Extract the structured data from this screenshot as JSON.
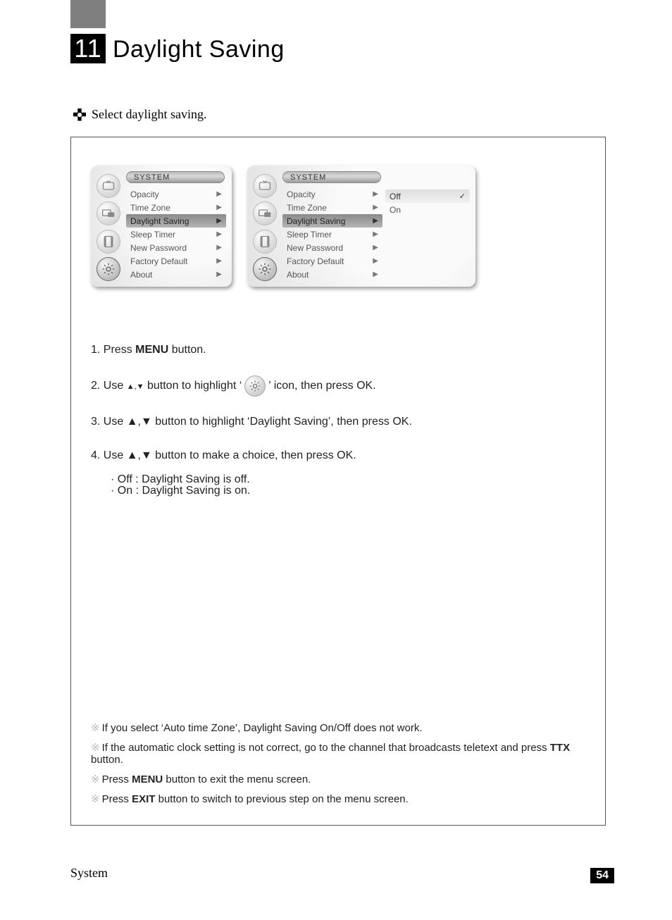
{
  "chapter": {
    "number": "11",
    "title": "Daylight Saving"
  },
  "intro": "Select daylight saving.",
  "osd": {
    "header": "SYSTEM",
    "items": [
      {
        "label": "Opacity",
        "selected": false
      },
      {
        "label": "Time Zone",
        "selected": false
      },
      {
        "label": "Daylight Saving",
        "selected": true
      },
      {
        "label": "Sleep Timer",
        "selected": false
      },
      {
        "label": "New Password",
        "selected": false
      },
      {
        "label": "Factory Default",
        "selected": false
      },
      {
        "label": "About",
        "selected": false
      }
    ],
    "options": [
      {
        "label": "Off",
        "selected": true
      },
      {
        "label": "On",
        "selected": false
      }
    ]
  },
  "steps": {
    "s1_pre": "1. Press ",
    "s1_b": "MENU",
    "s1_post": " button.",
    "s2_pre": "2. Use ",
    "s2_mid": " button to highlight ‘",
    "s2_post": "’ icon, then press OK.",
    "s3": "3. Use ▲,▼ button to highlight ‘Daylight Saving’, then press OK.",
    "s4": "4. Use ▲,▼ button to make a choice, then press OK.",
    "s4a": "· Off : Daylight Saving is off.",
    "s4b": "· On : Daylight Saving is on.",
    "arrows": "▲,▼"
  },
  "notes": {
    "n1": "If you select ‘Auto time Zone’, Daylight Saving On/Off does not work.",
    "n2_pre": "If the automatic clock setting is not correct, go to the channel that broadcasts teletext and press ",
    "n2_b": "TTX",
    "n2_post": " button.",
    "n3_pre": "Press ",
    "n3_b": "MENU",
    "n3_post": " button to exit the menu screen.",
    "n4_pre": "Press ",
    "n4_b": "EXIT",
    "n4_post": " button to switch to previous step on the menu screen."
  },
  "footer": {
    "section": "System",
    "page": "54"
  },
  "marker": "※"
}
